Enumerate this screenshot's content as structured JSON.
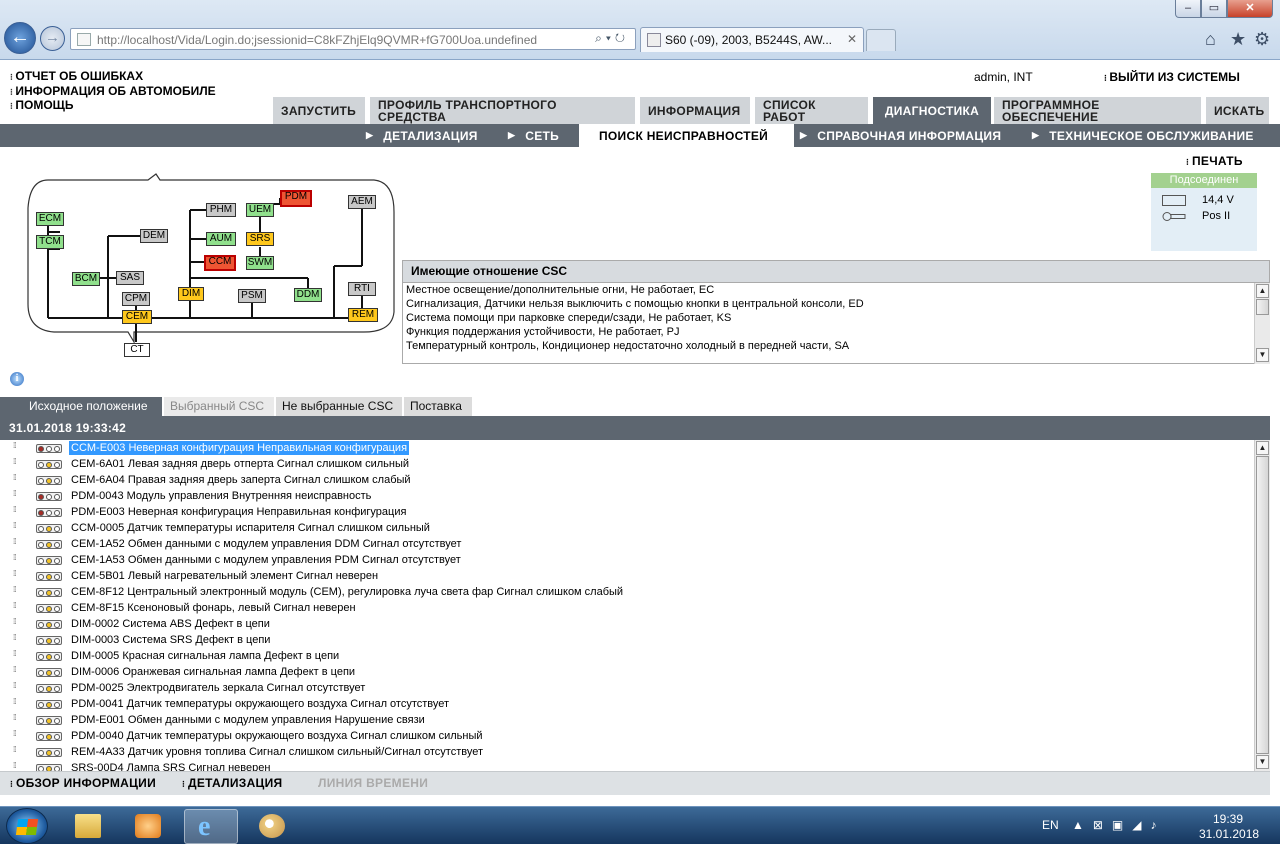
{
  "browser": {
    "url": "http://localhost/Vida/Login.do;jsessionid=C8kFZhjElq9QVMR+fG700Uoa.undefined",
    "tab_title": "S60 (-09), 2003, B5244S, AW...",
    "tab_close": "✕"
  },
  "header": {
    "links": [
      "ОТЧЕТ ОБ ОШИБКАХ",
      "ИНФОРМАЦИЯ ОБ АВТОМОБИЛЕ",
      "ПОМОЩЬ"
    ],
    "user": "admin, INT",
    "logout": "ВЫЙТИ ИЗ СИСТЕМЫ"
  },
  "main_tabs": [
    {
      "label": "ЗАПУСТИТЬ",
      "active": false
    },
    {
      "label": "ПРОФИЛЬ ТРАНСПОРТНОГО СРЕДСТВА",
      "active": false
    },
    {
      "label": "ИНФОРМАЦИЯ",
      "active": false
    },
    {
      "label": "СПИСОК РАБОТ",
      "active": false
    },
    {
      "label": "ДИАГНОСТИКА",
      "active": true
    },
    {
      "label": "ПРОГРАММНОЕ ОБЕСПЕЧЕНИЕ",
      "active": false
    },
    {
      "label": "ИСКАТЬ",
      "active": false
    }
  ],
  "sub_tabs": [
    {
      "label": "ДЕТАЛИЗАЦИЯ",
      "active": false
    },
    {
      "label": "СЕТЬ",
      "active": false
    },
    {
      "label": "ПОИСК НЕИСПРАВНОСТЕЙ",
      "active": true
    },
    {
      "label": "СПРАВОЧНАЯ ИНФОРМАЦИЯ",
      "active": false
    },
    {
      "label": "ТЕХНИЧЕСКОЕ ОБСЛУЖИВАНИЕ",
      "active": false
    }
  ],
  "print": "ПЕЧАТЬ",
  "status": {
    "connection": "Подсоединен",
    "voltage": "14,4 V",
    "ignition": "Pos II",
    "connection_color": "#a3d18f"
  },
  "diagram": {
    "modules": [
      "ECM",
      "TCM",
      "BCM",
      "SAS",
      "DEM",
      "CPM",
      "CEM",
      "CT",
      "PHM",
      "AUM",
      "CCM",
      "DIM",
      "UEM",
      "SRS",
      "SWM",
      "PDM",
      "PSM",
      "DDM",
      "AEM",
      "RTI",
      "REM"
    ]
  },
  "csc": {
    "title": "Имеющие отношение CSC",
    "items": [
      "Местное освещение/дополнительные огни, Не работает, EC",
      "Сигнализация, Датчики нельзя выключить с помощью кнопки в центральной консоли, ED",
      "Система помощи при парковке спереди/сзади, Не работает, KS",
      "Функция поддержания устойчивости, Не работает, PJ",
      "Температурный контроль, Кондиционер недостаточно холодный в передней части, SA"
    ]
  },
  "filter_tabs": [
    "Исходное положение",
    "Выбранный CSC",
    "Не выбранные CSC",
    "Поставка"
  ],
  "timestamp": "31.01.2018 19:33:42",
  "dtcs": [
    {
      "text": "CCM-E003 Неверная конфигурация Неправильная конфигурация",
      "light": "red",
      "selected": true
    },
    {
      "text": "CEM-6A01 Левая задняя дверь отперта Сигнал слишком сильный",
      "light": "yellow"
    },
    {
      "text": "CEM-6A04 Правая задняя дверь заперта Сигнал слишком слабый",
      "light": "yellow"
    },
    {
      "text": "PDM-0043 Модуль управления Внутренняя неисправность",
      "light": "red"
    },
    {
      "text": "PDM-E003 Неверная конфигурация Неправильная конфигурация",
      "light": "red"
    },
    {
      "text": "CCM-0005 Датчик температуры испарителя Сигнал слишком сильный",
      "light": "yellow"
    },
    {
      "text": "CEM-1A52 Обмен данными с модулем управления DDM Сигнал отсутствует",
      "light": "yellow"
    },
    {
      "text": "CEM-1A53 Обмен данными с модулем управления PDM Сигнал отсутствует",
      "light": "yellow"
    },
    {
      "text": "CEM-5B01 Левый нагревательный элемент Сигнал неверен",
      "light": "yellow"
    },
    {
      "text": "CEM-8F12 Центральный электронный модуль (CEM), регулировка луча света фар Сигнал слишком слабый",
      "light": "yellow"
    },
    {
      "text": "CEM-8F15 Ксеноновый фонарь, левый Сигнал неверен",
      "light": "yellow"
    },
    {
      "text": "DIM-0002 Система ABS Дефект в цепи",
      "light": "yellow"
    },
    {
      "text": "DIM-0003 Система SRS Дефект в цепи",
      "light": "yellow"
    },
    {
      "text": "DIM-0005 Красная сигнальная лампа Дефект в цепи",
      "light": "yellow"
    },
    {
      "text": "DIM-0006 Оранжевая сигнальная лампа Дефект в цепи",
      "light": "yellow"
    },
    {
      "text": "PDM-0025 Электродвигатель зеркала Сигнал отсутствует",
      "light": "yellow"
    },
    {
      "text": "PDM-0041 Датчик температуры окружающего воздуха Сигнал отсутствует",
      "light": "yellow"
    },
    {
      "text": "PDM-E001 Обмен данными с модулем управления Нарушение связи",
      "light": "yellow"
    },
    {
      "text": "PDM-0040 Датчик температуры окружающего воздуха Сигнал слишком сильный",
      "light": "yellow"
    },
    {
      "text": "REM-4A33 Датчик уровня топлива Сигнал слишком сильный/Сигнал отсутствует",
      "light": "yellow"
    },
    {
      "text": "SRS-00D4 Лампа SRS Сигнал неверен",
      "light": "yellow"
    }
  ],
  "bottom_bar": {
    "overview": "ОБЗОР ИНФОРМАЦИИ",
    "details": "ДЕТАЛИЗАЦИЯ",
    "timeline": "ЛИНИЯ ВРЕМЕНИ"
  },
  "taskbar": {
    "lang": "EN",
    "time": "19:39",
    "date": "31.01.2018"
  }
}
